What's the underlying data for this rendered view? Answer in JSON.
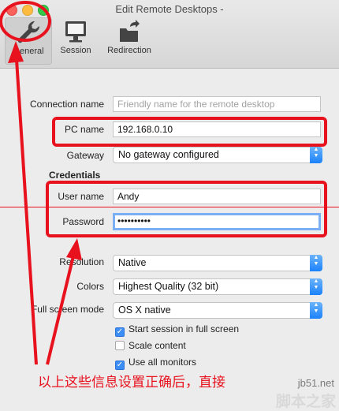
{
  "window": {
    "title": "Edit Remote Desktops -"
  },
  "toolbar": [
    {
      "id": "general",
      "label": "General",
      "icon": "wrench-icon",
      "selected": true
    },
    {
      "id": "session",
      "label": "Session",
      "icon": "monitor-icon",
      "selected": false
    },
    {
      "id": "redirection",
      "label": "Redirection",
      "icon": "folder-redirect-icon",
      "selected": false
    }
  ],
  "form": {
    "connection_name": {
      "label": "Connection name",
      "placeholder": "Friendly name for the remote desktop"
    },
    "pc_name": {
      "label": "PC name",
      "value": "192.168.0.10"
    },
    "gateway": {
      "label": "Gateway",
      "value": "No gateway configured"
    },
    "credentials_heading": "Credentials",
    "user_name": {
      "label": "User name",
      "value": "Andy"
    },
    "password": {
      "label": "Password",
      "value": "••••••••••"
    },
    "resolution": {
      "label": "Resolution",
      "value": "Native"
    },
    "colors": {
      "label": "Colors",
      "value": "Highest Quality (32 bit)"
    },
    "full_screen_mode": {
      "label": "Full screen mode",
      "value": "OS X native"
    },
    "checkboxes": [
      {
        "label": "Start session in full screen",
        "checked": true
      },
      {
        "label": "Scale content",
        "checked": false
      },
      {
        "label": "Use all monitors",
        "checked": true
      }
    ]
  },
  "annotation": {
    "caption": "以上这些信息设置正确后，直接",
    "color": "#e8111e"
  },
  "watermark": {
    "site": "jb51.net",
    "brand": "脚本之家"
  },
  "colors": {
    "accent": "#1a82fb",
    "focus_ring": "#7aaef5",
    "annotation_red": "#e8111e"
  }
}
